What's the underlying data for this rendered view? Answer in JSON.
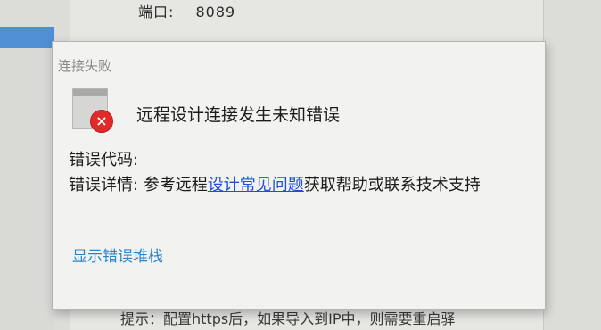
{
  "background": {
    "port_label": "端口:",
    "port_value": "8089",
    "hint_text": "提示：配置https后，如果导入到IP中，则需要重启驿"
  },
  "dialog": {
    "title": "连接失败",
    "message": "远程设计连接发生未知错误",
    "error_code_label": "错误代码:",
    "error_detail_label": "错误详情:",
    "error_detail_prefix": "参考远程",
    "faq_link": "设计常见问题",
    "error_detail_suffix": "获取帮助或联系技术支持",
    "show_stack_link": "显示错误堆栈",
    "error_icon": "error-x-icon"
  }
}
